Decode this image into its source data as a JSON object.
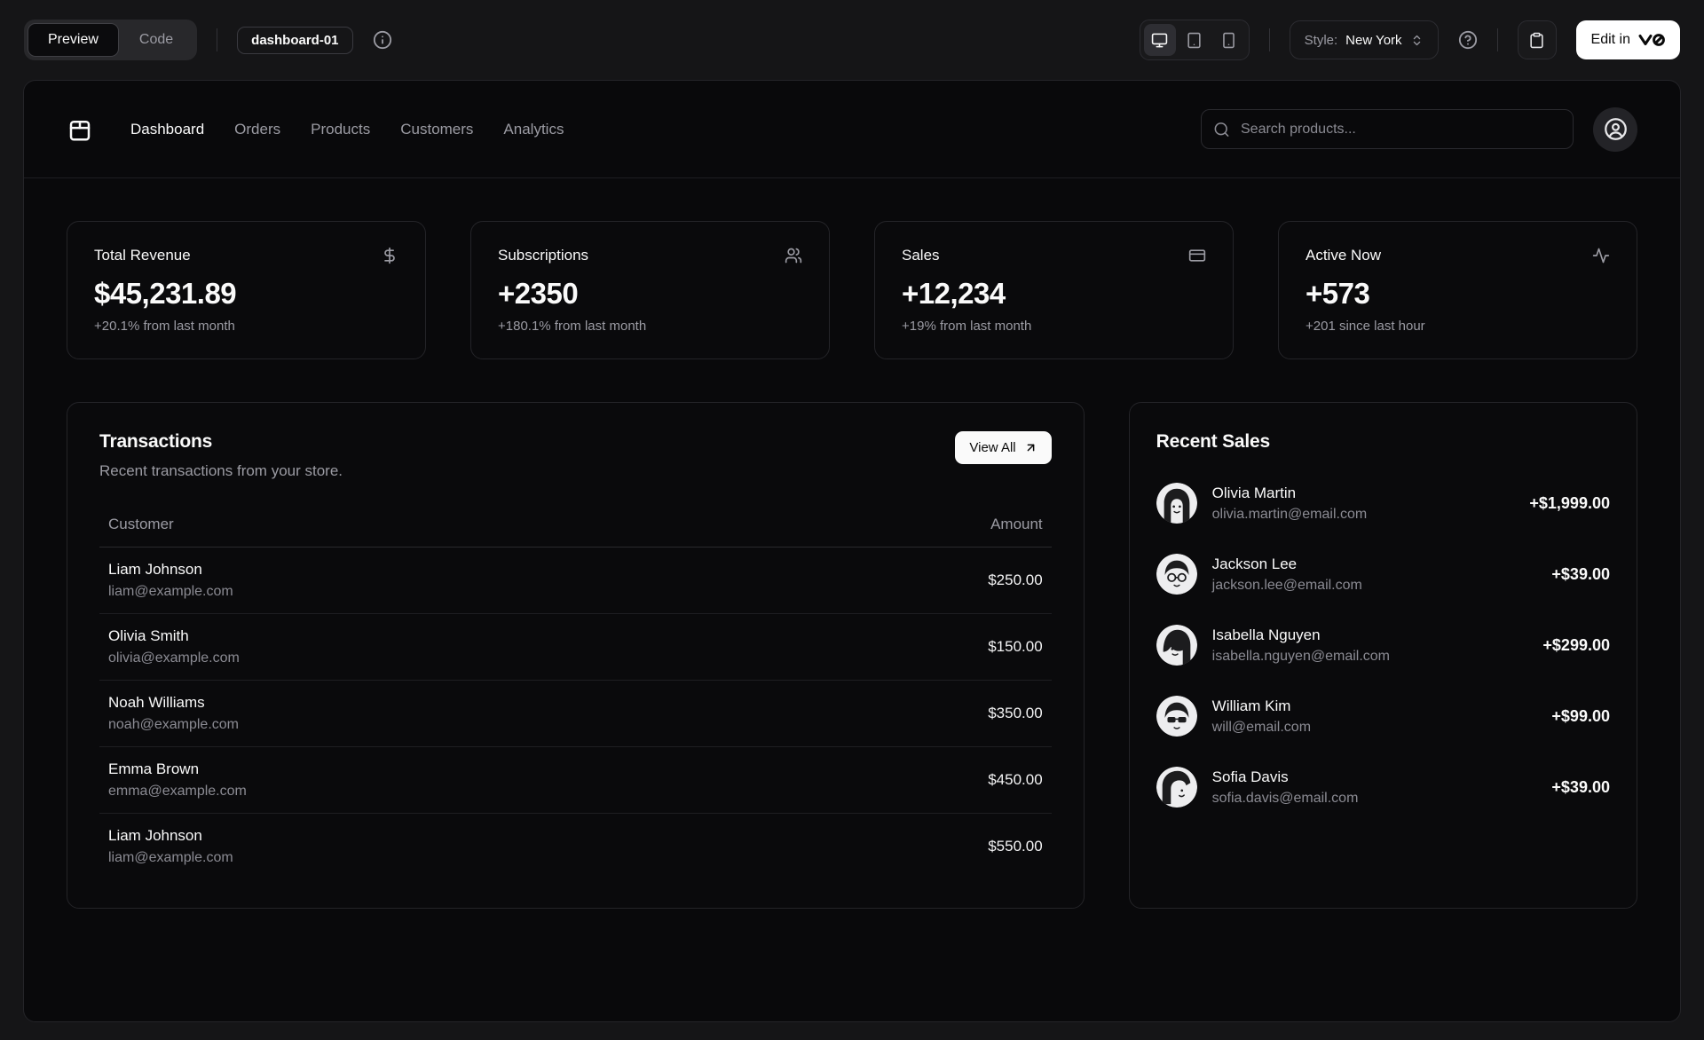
{
  "toolbar": {
    "view_toggle": {
      "preview": "Preview",
      "code": "Code"
    },
    "block_badge": "dashboard-01",
    "style": {
      "label": "Style:",
      "value": "New York"
    },
    "edit_button_label": "Edit in",
    "icons": {
      "info": "info-circle",
      "devices": [
        "desktop-monitor",
        "tablet",
        "smartphone"
      ],
      "style_chevrons": "chevrons-up-down",
      "help": "question-circle",
      "clipboard": "clipboard",
      "edit_logo": "v0-logo"
    }
  },
  "nav": {
    "logo_icon": "store-bag",
    "items": [
      {
        "label": "Dashboard",
        "active": true
      },
      {
        "label": "Orders",
        "active": false
      },
      {
        "label": "Products",
        "active": false
      },
      {
        "label": "Customers",
        "active": false
      },
      {
        "label": "Analytics",
        "active": false
      }
    ],
    "search_placeholder": "Search products...",
    "account_icon": "circle-user"
  },
  "stats": [
    {
      "title": "Total Revenue",
      "icon": "dollar-sign",
      "value": "$45,231.89",
      "change": "+20.1% from last month"
    },
    {
      "title": "Subscriptions",
      "icon": "users",
      "value": "+2350",
      "change": "+180.1% from last month"
    },
    {
      "title": "Sales",
      "icon": "credit-card",
      "value": "+12,234",
      "change": "+19% from last month"
    },
    {
      "title": "Active Now",
      "icon": "activity",
      "value": "+573",
      "change": "+201 since last hour"
    }
  ],
  "transactions": {
    "title": "Transactions",
    "subtitle": "Recent transactions from your store.",
    "view_all_label": "View All",
    "view_all_icon": "arrow-up-right",
    "columns": [
      "Customer",
      "Amount"
    ],
    "rows": [
      {
        "name": "Liam Johnson",
        "email": "liam@example.com",
        "amount": "$250.00"
      },
      {
        "name": "Olivia Smith",
        "email": "olivia@example.com",
        "amount": "$150.00"
      },
      {
        "name": "Noah Williams",
        "email": "noah@example.com",
        "amount": "$350.00"
      },
      {
        "name": "Emma Brown",
        "email": "emma@example.com",
        "amount": "$450.00"
      },
      {
        "name": "Liam Johnson",
        "email": "liam@example.com",
        "amount": "$550.00"
      }
    ]
  },
  "recent_sales": {
    "title": "Recent Sales",
    "items": [
      {
        "name": "Olivia Martin",
        "email": "olivia.martin@email.com",
        "amount": "+$1,999.00"
      },
      {
        "name": "Jackson Lee",
        "email": "jackson.lee@email.com",
        "amount": "+$39.00"
      },
      {
        "name": "Isabella Nguyen",
        "email": "isabella.nguyen@email.com",
        "amount": "+$299.00"
      },
      {
        "name": "William Kim",
        "email": "will@email.com",
        "amount": "+$99.00"
      },
      {
        "name": "Sofia Davis",
        "email": "sofia.davis@email.com",
        "amount": "+$39.00"
      }
    ]
  },
  "colors": {
    "page_background": "#151517",
    "panel_background": "#09090b",
    "border": "#26262a",
    "muted_text": "#9b9ba3",
    "primary_text": "#fafafa",
    "primary_button_bg": "#fafafa",
    "primary_button_text": "#0a0a0a"
  }
}
